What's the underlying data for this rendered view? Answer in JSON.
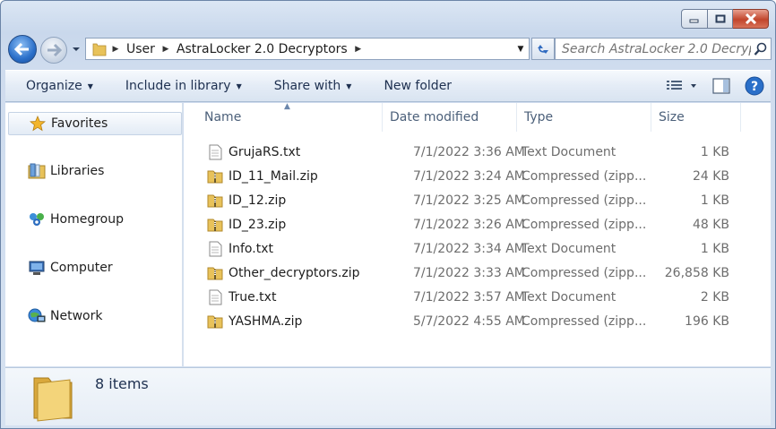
{
  "window": {
    "caption": {
      "minimize": "minimize",
      "maximize": "maximize",
      "close": "close"
    }
  },
  "nav": {
    "breadcrumbs": [
      "User",
      "AstraLocker 2.0 Decryptors"
    ]
  },
  "search": {
    "placeholder": "Search AstraLocker 2.0 Decryp..."
  },
  "toolbar": {
    "organize": "Organize",
    "include_in_library": "Include in library",
    "share_with": "Share with",
    "new_folder": "New folder"
  },
  "sidebar": {
    "favorites": "Favorites",
    "items": [
      {
        "label": "Libraries",
        "icon": "libraries-icon"
      },
      {
        "label": "Homegroup",
        "icon": "homegroup-icon"
      },
      {
        "label": "Computer",
        "icon": "computer-icon"
      },
      {
        "label": "Network",
        "icon": "network-icon"
      }
    ]
  },
  "columns": {
    "name": "Name",
    "date": "Date modified",
    "type": "Type",
    "size": "Size"
  },
  "files": [
    {
      "name": "GrujaRS.txt",
      "date": "7/1/2022 3:36 AM",
      "type": "Text Document",
      "size": "1 KB",
      "icon": "text-file-icon"
    },
    {
      "name": "ID_11_Mail.zip",
      "date": "7/1/2022 3:24 AM",
      "type": "Compressed (zipp...",
      "size": "24 KB",
      "icon": "zip-folder-icon"
    },
    {
      "name": "ID_12.zip",
      "date": "7/1/2022 3:25 AM",
      "type": "Compressed (zipp...",
      "size": "1 KB",
      "icon": "zip-folder-icon"
    },
    {
      "name": "ID_23.zip",
      "date": "7/1/2022 3:26 AM",
      "type": "Compressed (zipp...",
      "size": "48 KB",
      "icon": "zip-folder-icon"
    },
    {
      "name": "Info.txt",
      "date": "7/1/2022 3:34 AM",
      "type": "Text Document",
      "size": "1 KB",
      "icon": "text-file-icon"
    },
    {
      "name": "Other_decryptors.zip",
      "date": "7/1/2022 3:33 AM",
      "type": "Compressed (zipp...",
      "size": "26,858 KB",
      "icon": "zip-folder-icon"
    },
    {
      "name": "True.txt",
      "date": "7/1/2022 3:57 AM",
      "type": "Text Document",
      "size": "2 KB",
      "icon": "text-file-icon"
    },
    {
      "name": "YASHMA.zip",
      "date": "5/7/2022 4:55 AM",
      "type": "Compressed (zipp...",
      "size": "196 KB",
      "icon": "zip-folder-icon"
    }
  ],
  "details": {
    "count": "8 items"
  },
  "colors": {
    "accent": "#2a6fc9",
    "close": "#c2452c",
    "folder": "#e8c25a"
  }
}
